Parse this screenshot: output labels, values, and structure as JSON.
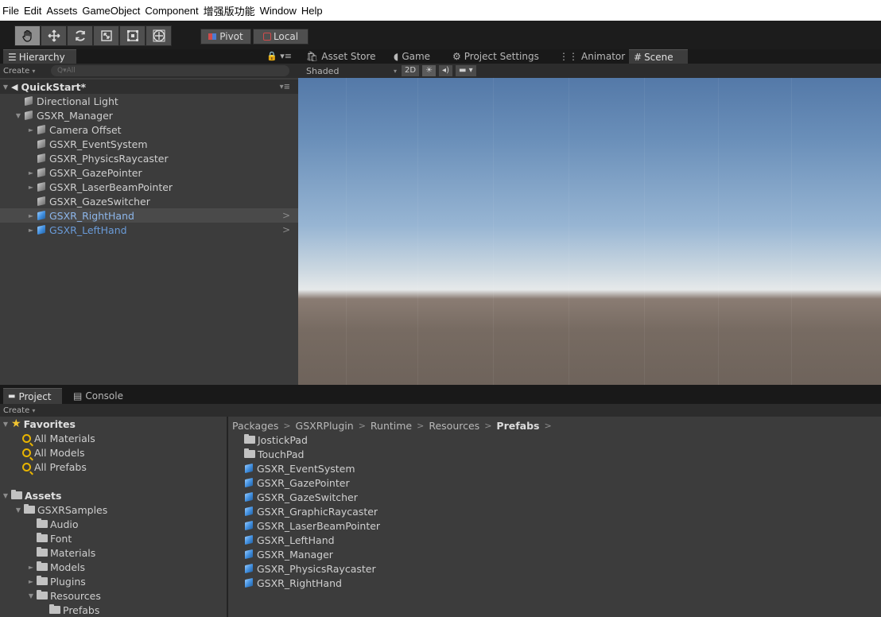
{
  "menubar": [
    "File",
    "Edit",
    "Assets",
    "GameObject",
    "Component",
    "增强版功能",
    "Window",
    "Help"
  ],
  "toolbar": {
    "tools": [
      {
        "name": "hand-tool-icon",
        "active": true
      },
      {
        "name": "move-tool-icon",
        "active": false
      },
      {
        "name": "rotate-tool-icon",
        "active": false
      },
      {
        "name": "scale-tool-icon",
        "active": false
      },
      {
        "name": "rect-tool-icon",
        "active": false
      },
      {
        "name": "transform-tool-icon",
        "active": false
      }
    ],
    "pivot_label": "Pivot",
    "local_label": "Local"
  },
  "hierarchy": {
    "tab_label": "Hierarchy",
    "create_label": "Create",
    "search_placeholder": "Q▾All",
    "scene_name": "QuickStart*",
    "items": [
      {
        "label": "Directional Light",
        "indent": 1,
        "arrow": "",
        "blue": false,
        "selected": false
      },
      {
        "label": "GSXR_Manager",
        "indent": 1,
        "arrow": "▼",
        "blue": false,
        "selected": false
      },
      {
        "label": "Camera Offset",
        "indent": 2,
        "arrow": "►",
        "blue": false,
        "selected": false
      },
      {
        "label": "GSXR_EventSystem",
        "indent": 2,
        "arrow": "",
        "blue": false,
        "selected": false
      },
      {
        "label": "GSXR_PhysicsRaycaster",
        "indent": 2,
        "arrow": "",
        "blue": false,
        "selected": false
      },
      {
        "label": "GSXR_GazePointer",
        "indent": 2,
        "arrow": "►",
        "blue": false,
        "selected": false
      },
      {
        "label": "GSXR_LaserBeamPointer",
        "indent": 2,
        "arrow": "►",
        "blue": false,
        "selected": false
      },
      {
        "label": "GSXR_GazeSwitcher",
        "indent": 2,
        "arrow": "",
        "blue": false,
        "selected": false
      },
      {
        "label": "GSXR_RightHand",
        "indent": 2,
        "arrow": "►",
        "blue": true,
        "selected": true
      },
      {
        "label": "GSXR_LeftHand",
        "indent": 2,
        "arrow": "►",
        "blue": true,
        "selected": false
      }
    ]
  },
  "scene_tabs": [
    {
      "label": "Asset Store",
      "icon": "store-icon"
    },
    {
      "label": "Game",
      "icon": "pacman-icon"
    },
    {
      "label": "Project Settings",
      "icon": "gear-icon"
    },
    {
      "label": "Animator",
      "icon": "animator-icon"
    },
    {
      "label": "Scene",
      "icon": "grid-icon",
      "active": true
    }
  ],
  "scene_toolbar": {
    "shading_mode": "Shaded",
    "mode_2d": "2D"
  },
  "project": {
    "tabs": [
      {
        "label": "Project",
        "icon": "folder-icon",
        "active": true
      },
      {
        "label": "Console",
        "icon": "console-icon",
        "active": false
      }
    ],
    "create_label": "Create",
    "favorites_label": "Favorites",
    "favorites": [
      "All Materials",
      "All Models",
      "All Prefabs"
    ],
    "assets_label": "Assets",
    "tree": [
      {
        "label": "GSXRSamples",
        "arrow": "▼",
        "indent": 1
      },
      {
        "label": "Audio",
        "arrow": "",
        "indent": 2
      },
      {
        "label": "Font",
        "arrow": "",
        "indent": 2
      },
      {
        "label": "Materials",
        "arrow": "",
        "indent": 2
      },
      {
        "label": "Models",
        "arrow": "►",
        "indent": 2
      },
      {
        "label": "Plugins",
        "arrow": "►",
        "indent": 2
      },
      {
        "label": "Resources",
        "arrow": "▼",
        "indent": 2
      },
      {
        "label": "Prefabs",
        "arrow": "",
        "indent": 3
      }
    ],
    "breadcrumb": [
      "Packages",
      "GSXRPlugin",
      "Runtime",
      "Resources",
      "Prefabs"
    ],
    "contents": [
      {
        "label": "JostickPad",
        "type": "folder"
      },
      {
        "label": "TouchPad",
        "type": "folder"
      },
      {
        "label": "GSXR_EventSystem",
        "type": "prefab"
      },
      {
        "label": "GSXR_GazePointer",
        "type": "prefab"
      },
      {
        "label": "GSXR_GazeSwitcher",
        "type": "prefab"
      },
      {
        "label": "GSXR_GraphicRaycaster",
        "type": "prefab"
      },
      {
        "label": "GSXR_LaserBeamPointer",
        "type": "prefab"
      },
      {
        "label": "GSXR_LeftHand",
        "type": "prefab"
      },
      {
        "label": "GSXR_Manager",
        "type": "prefab"
      },
      {
        "label": "GSXR_PhysicsRaycaster",
        "type": "prefab"
      },
      {
        "label": "GSXR_RightHand",
        "type": "prefab"
      }
    ]
  }
}
